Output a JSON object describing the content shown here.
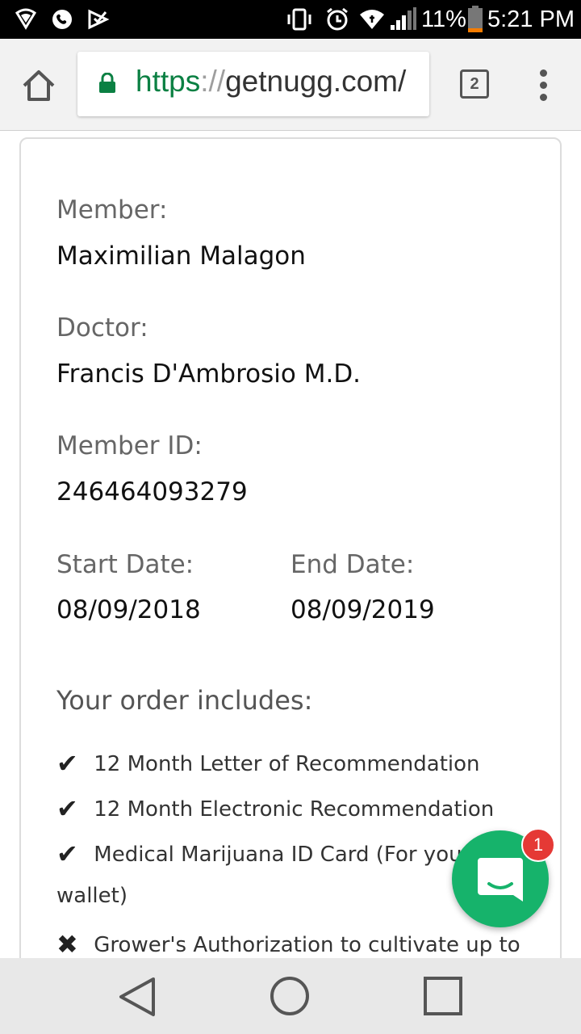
{
  "status_bar": {
    "battery_percent": "11%",
    "time": "5:21 PM"
  },
  "browser": {
    "url_scheme": "https",
    "url_separator": "://",
    "url_host": "getnugg.com/",
    "tab_count": "2"
  },
  "card": {
    "member_label": "Member:",
    "member_value": "Maximilian Malagon",
    "doctor_label": "Doctor:",
    "doctor_value": "Francis D'Ambrosio M.D.",
    "member_id_label": "Member ID:",
    "member_id_value": "246464093279",
    "start_date_label": "Start Date:",
    "start_date_value": "08/09/2018",
    "end_date_label": "End Date:",
    "end_date_value": "08/09/2019",
    "includes_title": "Your order includes:",
    "includes": [
      {
        "icon": "check-icon",
        "glyph": "✔",
        "text": "12 Month Letter of Recommendation"
      },
      {
        "icon": "check-icon",
        "glyph": "✔",
        "text": "12 Month Electronic Recommendation"
      },
      {
        "icon": "check-icon",
        "glyph": "✔",
        "text": "Medical Marijuana ID Card (For you",
        "continuation": "wallet)"
      },
      {
        "icon": "x-icon",
        "glyph": "✖",
        "text": "Grower's Authorization to cultivate up to"
      }
    ]
  },
  "chat": {
    "badge_count": "1",
    "accent": "#16b36b"
  }
}
